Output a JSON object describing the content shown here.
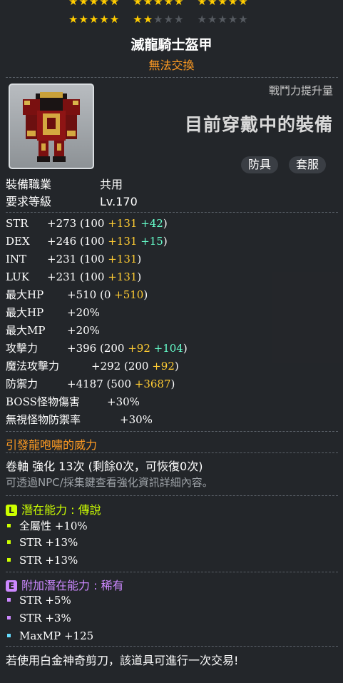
{
  "stars": {
    "row1": [
      "★★★★★",
      "★★★★★",
      "★★★★★"
    ],
    "row2": {
      "group1": "★★★★★",
      "group2_on": "★★",
      "group2_off": "★★★",
      "group3_off": "★★★★★"
    }
  },
  "item": {
    "name": "滅龍騎士盔甲",
    "trade": "無法交換"
  },
  "panel": {
    "cp_label": "戰鬥力提升量",
    "worn_label": "目前穿戴中的裝備",
    "tag_armor": "防具",
    "tag_set": "套服"
  },
  "info": {
    "job_label": "裝備職業",
    "job_value": "共用",
    "level_label": "要求等級",
    "level_value": "Lv.170"
  },
  "stats": [
    {
      "label": "STR",
      "base": "+273 (100 ",
      "y": "+131",
      "c": " +42",
      ")": ")"
    },
    {
      "label": "DEX",
      "base": "+246 (100 ",
      "y": "+131",
      "c": " +15",
      ")": ")"
    },
    {
      "label": "INT",
      "base": "+231 (100 ",
      "y": "+131",
      "c": "",
      ")": ")"
    },
    {
      "label": "LUK",
      "base": "+231 (100 ",
      "y": "+131",
      "c": "",
      ")": ")"
    },
    {
      "label": "最大HP",
      "base": "+510 (0 ",
      "y": "+510",
      "c": "",
      ")": ")"
    },
    {
      "label": "最大HP",
      "base": "+20%",
      "y": "",
      "c": "",
      ")": ""
    },
    {
      "label": "最大MP",
      "base": "+20%",
      "y": "",
      "c": "",
      ")": ""
    },
    {
      "label": "攻擊力",
      "base": "+396 (200 ",
      "y": "+92",
      "c": " +104",
      ")": ")"
    },
    {
      "label": "魔法攻擊力",
      "base": "+292 (200 ",
      "y": "+92",
      "c": "",
      ")": ")"
    },
    {
      "label": "防禦力",
      "base": "+4187 (500 ",
      "y": "+3687",
      "c": "",
      ")": ")"
    },
    {
      "label": "BOSS怪物傷害",
      "base": "+30%",
      "y": "",
      "c": "",
      ")": ""
    },
    {
      "label": "無視怪物防禦率",
      "base": "+30%",
      "y": "",
      "c": "",
      ")": ""
    }
  ],
  "set_effect": "引發龍咆嘯的威力",
  "scroll": {
    "line": "卷軸 強化 13次 (剩餘0次，可恢復0次)",
    "hint": "可透過NPC/採集鍵查看強化資訊詳細內容。"
  },
  "potential": {
    "badge": "L",
    "title": "潛在能力 : 傳說",
    "color": "#ccff00",
    "lines": [
      "全屬性 +10%",
      "STR +13%",
      "STR +13%"
    ]
  },
  "bonus_potential": {
    "badge": "E",
    "title": "附加潛在能力 : 稀有",
    "color": "#cc88ff",
    "lines": [
      "STR +5%",
      "STR +3%",
      "MaxMP +125"
    ]
  },
  "footer": "若使用白金神奇剪刀，該道具可進行一次交易!"
}
